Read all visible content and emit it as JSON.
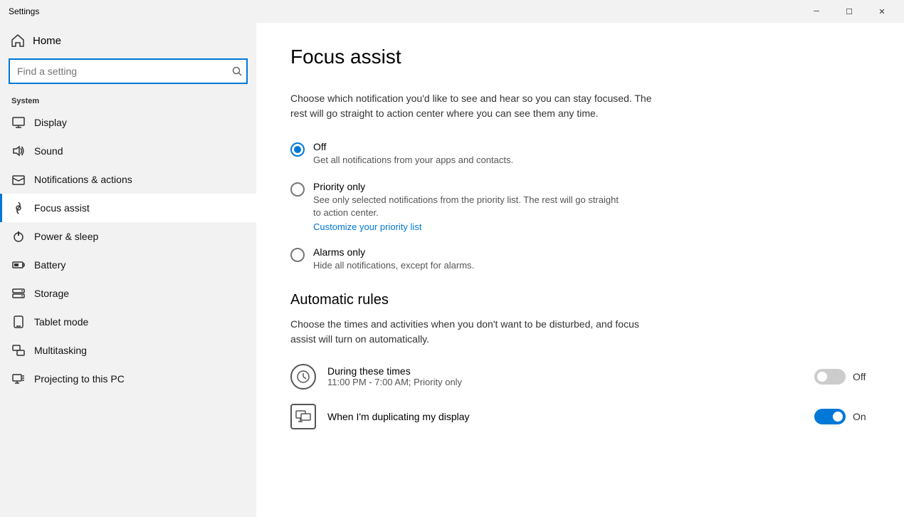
{
  "titlebar": {
    "title": "Settings",
    "minimize_label": "─",
    "maximize_label": "☐",
    "close_label": "✕"
  },
  "sidebar": {
    "home_label": "Home",
    "search_placeholder": "Find a setting",
    "section_label": "System",
    "items": [
      {
        "id": "display",
        "label": "Display",
        "icon": "display"
      },
      {
        "id": "sound",
        "label": "Sound",
        "icon": "sound"
      },
      {
        "id": "notifications",
        "label": "Notifications & actions",
        "icon": "notifications"
      },
      {
        "id": "focus",
        "label": "Focus assist",
        "icon": "focus",
        "active": true
      },
      {
        "id": "power",
        "label": "Power & sleep",
        "icon": "power"
      },
      {
        "id": "battery",
        "label": "Battery",
        "icon": "battery"
      },
      {
        "id": "storage",
        "label": "Storage",
        "icon": "storage"
      },
      {
        "id": "tablet",
        "label": "Tablet mode",
        "icon": "tablet"
      },
      {
        "id": "multitasking",
        "label": "Multitasking",
        "icon": "multitasking"
      },
      {
        "id": "projecting",
        "label": "Projecting to this PC",
        "icon": "projecting"
      }
    ]
  },
  "content": {
    "page_title": "Focus assist",
    "description": "Choose which notification you'd like to see and hear so you can stay focused. The rest will go straight to action center where you can see them any time.",
    "radio_options": [
      {
        "id": "off",
        "label": "Off",
        "sublabel": "Get all notifications from your apps and contacts.",
        "selected": true
      },
      {
        "id": "priority",
        "label": "Priority only",
        "sublabel": "See only selected notifications from the priority list. The rest will go straight to action center.",
        "link": "Customize your priority list",
        "selected": false
      },
      {
        "id": "alarms",
        "label": "Alarms only",
        "sublabel": "Hide all notifications, except for alarms.",
        "selected": false
      }
    ],
    "automatic_rules_title": "Automatic rules",
    "automatic_rules_desc": "Choose the times and activities when you don't want to be disturbed, and focus assist will turn on automatically.",
    "rules": [
      {
        "id": "during-times",
        "icon": "clock",
        "title": "During these times",
        "sub": "11:00 PM - 7:00 AM; Priority only",
        "toggle": false,
        "toggle_label": "Off"
      },
      {
        "id": "duplicating-display",
        "icon": "display",
        "title": "When I'm duplicating my display",
        "sub": "",
        "toggle": true,
        "toggle_label": "On"
      }
    ]
  }
}
